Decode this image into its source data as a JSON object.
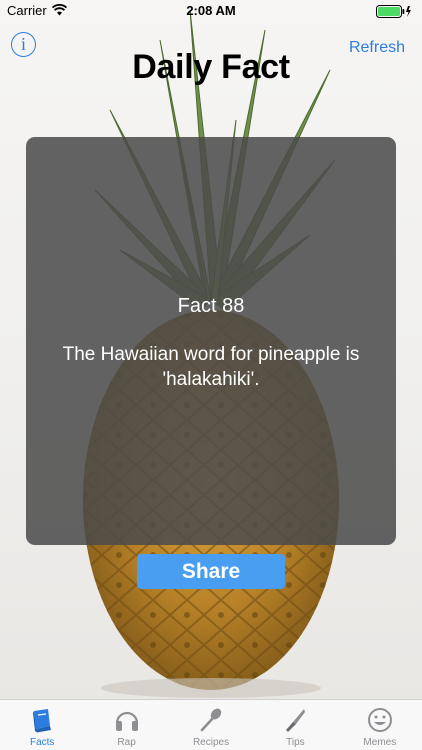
{
  "status_bar": {
    "carrier": "Carrier",
    "time": "2:08 AM"
  },
  "nav": {
    "info_label": "i",
    "refresh_label": "Refresh",
    "title": "Daily Fact"
  },
  "fact": {
    "number_label": "Fact 88",
    "text": "The Hawaiian word for pineapple is 'halakahiki'."
  },
  "share_label": "Share",
  "tabs": [
    {
      "label": "Facts",
      "icon": "book-icon",
      "active": true
    },
    {
      "label": "Rap",
      "icon": "headphones-icon",
      "active": false
    },
    {
      "label": "Recipes",
      "icon": "spoon-icon",
      "active": false
    },
    {
      "label": "Tips",
      "icon": "knife-icon",
      "active": false
    },
    {
      "label": "Memes",
      "icon": "smiley-icon",
      "active": false
    }
  ],
  "colors": {
    "accent": "#2b7de0",
    "share_button": "#4a9ef2",
    "card": "#4a4a4a",
    "inactive_tab": "#8e8e93",
    "battery": "#4cd964"
  }
}
